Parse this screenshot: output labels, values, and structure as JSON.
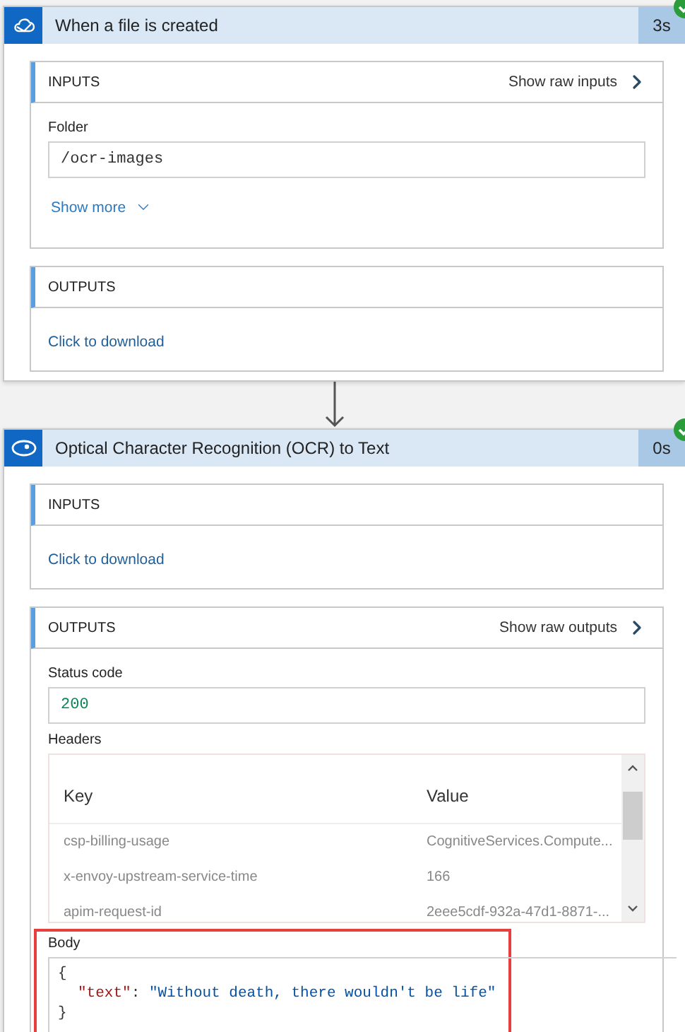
{
  "cards": [
    {
      "kind": "storage",
      "title": "When a file is created",
      "duration": "3s",
      "succeeded": true,
      "sections": [
        {
          "title": "INPUTS",
          "action": "Show raw inputs",
          "items": [
            {
              "kind": "text_field",
              "label": "Folder",
              "value": "/ocr-images"
            },
            {
              "kind": "more",
              "text": "Show more"
            }
          ]
        },
        {
          "title": "OUTPUTS",
          "items": [
            {
              "kind": "download",
              "text": "Click to download"
            }
          ]
        }
      ]
    },
    {
      "kind": "vision",
      "title": "Optical Character Recognition (OCR) to Text",
      "duration": "0s",
      "succeeded": true,
      "sections": [
        {
          "title": "INPUTS",
          "items": [
            {
              "kind": "download",
              "text": "Click to download"
            }
          ]
        },
        {
          "title": "OUTPUTS",
          "action": "Show raw outputs",
          "items": [
            {
              "kind": "number_field",
              "label": "Status code",
              "value": "200"
            },
            {
              "kind": "table",
              "label": "Headers",
              "columns": [
                "Key",
                "Value"
              ],
              "rows": [
                [
                  "csp-billing-usage",
                  "CognitiveServices.Compute..."
                ],
                [
                  "x-envoy-upstream-service-time",
                  "166"
                ],
                [
                  "apim-request-id",
                  "2eee5cdf-932a-47d1-8871-..."
                ]
              ]
            },
            {
              "kind": "body",
              "label": "Body",
              "highlighted": true,
              "open": "{",
              "key": "\"text\"",
              "colon": ":",
              "value": "\"Without death, there wouldn't be life\"",
              "close": "}"
            }
          ]
        }
      ]
    }
  ]
}
